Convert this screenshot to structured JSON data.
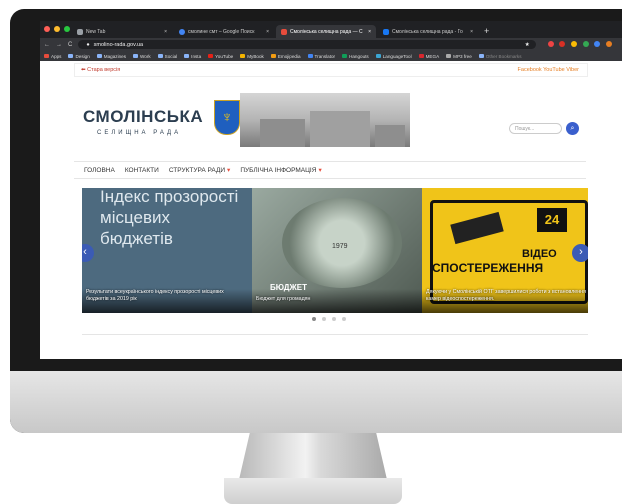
{
  "browser": {
    "tabs": [
      {
        "label": "New Tab",
        "color": "#9aa0a6"
      },
      {
        "label": "смолине смт – Google Поиск",
        "color": "#4285f4"
      },
      {
        "label": "Смолінська селищна рада — С",
        "color": "#e74c3c",
        "active": true
      },
      {
        "label": "Смолінська селищна рада - Го",
        "color": "#1877f2"
      }
    ],
    "new_tab": "+",
    "url": "smolino-rada.gov.ua",
    "bookmarks": [
      "Apps",
      "Design",
      "Magazines",
      "Work",
      "Social",
      "Insta",
      "YouTube",
      "MyBook",
      "Emojipedia",
      "Translator",
      "Hangouts",
      "LanguageTool",
      "MEGA",
      "MP3 free",
      "Other Bookmarks"
    ]
  },
  "site": {
    "old_version": "Стара версія",
    "social": "Facebook  YouTube  Viber",
    "title": "СМОЛІНСЬКА",
    "subtitle": "СЕЛИЩНА РАДА",
    "search_placeholder": "Пошук...",
    "nav": [
      "ГОЛОВНА",
      "КОНТАКТИ",
      "СТРУКТУРА РАДИ",
      "ПУБЛІЧНА ІНФОРМАЦІЯ"
    ],
    "slides": [
      {
        "big_text": "Індекс прозорості місцевих бюджетів",
        "caption": "Результати всеукраїнського індексу прозорості місцевих бюджетів за 2019 рік"
      },
      {
        "heading": "БЮДЖЕТ",
        "caption": "Бюджет для громадян",
        "year": "1979"
      },
      {
        "badge": "24",
        "line1": "ВІДЕО",
        "line2": "СПОСТЕРЕЖЕННЯ",
        "caption": "Дякуючи у Смолінській ОТГ завершилися роботи з встановлення камер відеоспостереження."
      }
    ],
    "prev": "‹",
    "next": "›"
  }
}
